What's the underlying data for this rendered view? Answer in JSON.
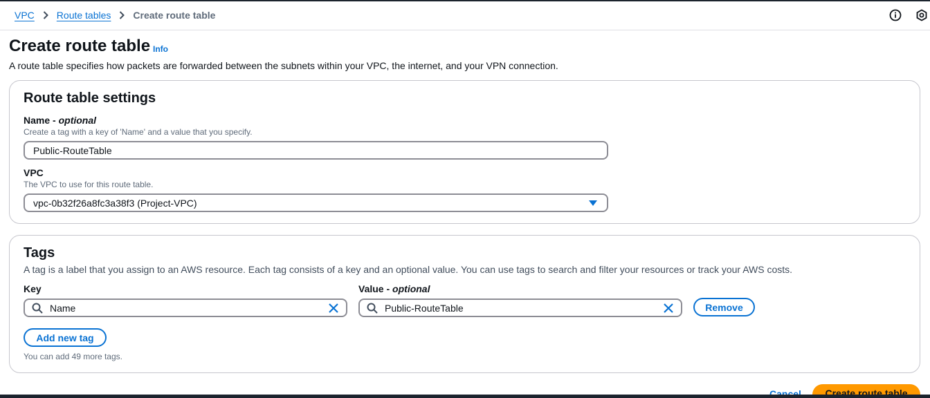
{
  "breadcrumb": {
    "items": [
      "VPC",
      "Route tables"
    ],
    "current": "Create route table"
  },
  "header": {
    "title": "Create route table",
    "info_label": "Info",
    "description": "A route table specifies how packets are forwarded between the subnets within your VPC, the internet, and your VPN connection."
  },
  "settings": {
    "title": "Route table settings",
    "name_label": "Name",
    "name_optional": "optional",
    "name_hint": "Create a tag with a key of 'Name' and a value that you specify.",
    "name_value": "Public-RouteTable",
    "vpc_label": "VPC",
    "vpc_hint": "The VPC to use for this route table.",
    "vpc_value": "vpc-0b32f26a8fc3a38f3 (Project-VPC)"
  },
  "tags": {
    "title": "Tags",
    "description": "A tag is a label that you assign to an AWS resource. Each tag consists of a key and an optional value. You can use tags to search and filter your resources or track your AWS costs.",
    "key_label": "Key",
    "value_label": "Value",
    "value_optional": "optional",
    "key_value": "Name",
    "value_value": "Public-RouteTable",
    "remove_label": "Remove",
    "add_label": "Add new tag",
    "limit_hint": "You can add 49 more tags."
  },
  "footer": {
    "cancel_label": "Cancel",
    "create_label": "Create route table"
  },
  "colors": {
    "link": "#0972d3",
    "primary_button": "#ff9900",
    "border": "#8c8c94"
  },
  "icons": {
    "info": "info-circle-icon",
    "settings": "settings-icon",
    "search": "search-icon",
    "clear": "close-icon",
    "caret": "caret-down-icon",
    "separator": "chevron-right-icon"
  }
}
